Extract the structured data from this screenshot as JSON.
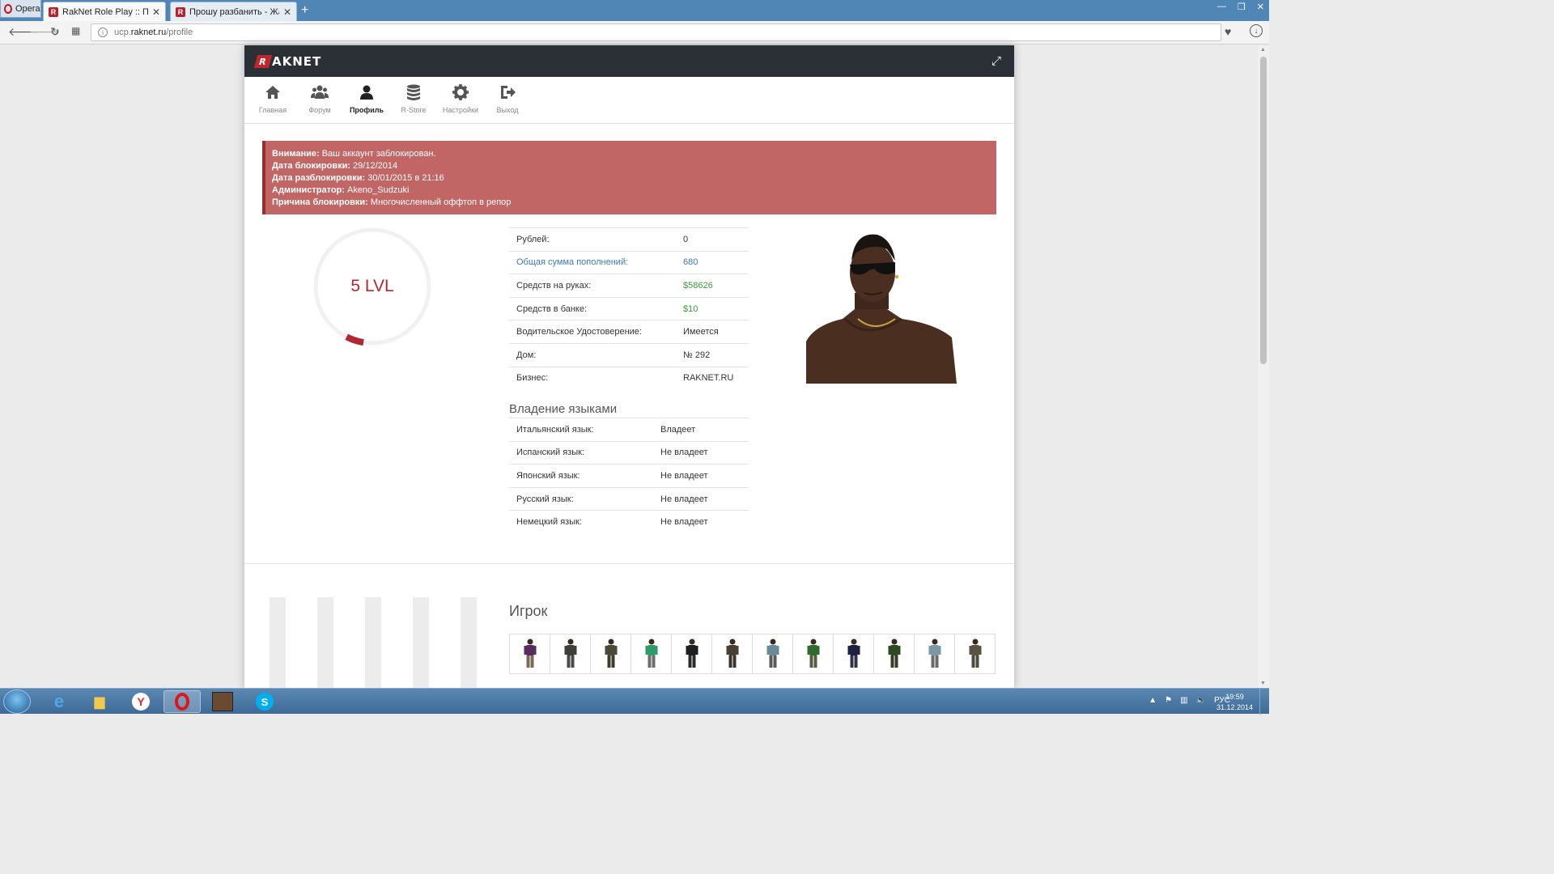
{
  "browser": {
    "menu_label": "Opera",
    "tabs": [
      {
        "title": "RakNet Role Play :: Профиль"
      },
      {
        "title": "Прошу разбанить - Жалобы"
      }
    ],
    "url_host": "ucp.",
    "url_domain": "raknet.ru",
    "url_path": "/profile"
  },
  "site": {
    "logo_text": "AKNET",
    "logo_mark": "R",
    "nav": [
      {
        "label": "Главная",
        "icon": "home-icon"
      },
      {
        "label": "Форум",
        "icon": "users-icon"
      },
      {
        "label": "Профиль",
        "icon": "user-icon"
      },
      {
        "label": "R-Store",
        "icon": "database-icon"
      },
      {
        "label": "Настройки",
        "icon": "gear-icon"
      },
      {
        "label": "Выход",
        "icon": "signout-icon"
      }
    ],
    "active_nav": "Профиль"
  },
  "ban": {
    "warning_label": "Внимание:",
    "warning_text": " Ваш аккаунт заблокирован.",
    "date_label": "Дата блокировки:",
    "date": " 29/12/2014",
    "unban_label": "Дата разблокировки:",
    "unban": " 30/01/2015 в 21:16",
    "admin_label": "Администратор:",
    "admin": " Akeno_Sudzuki",
    "reason_label": "Причина блокировки:",
    "reason": " Многочисленный оффтоп в репор"
  },
  "level": {
    "label": "5 LVL",
    "progress": 0.05,
    "color": "#b3262f"
  },
  "stats": [
    {
      "key": "Рублей:",
      "value": "0"
    },
    {
      "key": "Общая сумма пополнений:",
      "value": "680"
    },
    {
      "key": "Средств на руках:",
      "value": "$58626"
    },
    {
      "key": "Средств в банке:",
      "value": "$10"
    },
    {
      "key": "Водительское Удостоверение:",
      "value": "Имеется"
    },
    {
      "key": "Дом:",
      "value": "№ 292"
    },
    {
      "key": "Бизнес:",
      "value": "RAKNET.RU"
    }
  ],
  "languages_title": "Владение языками",
  "languages": [
    {
      "key": "Итальянский язык:",
      "value": "Владеет"
    },
    {
      "key": "Испанский язык:",
      "value": "Не владеет"
    },
    {
      "key": "Японский язык:",
      "value": "Не владеет"
    },
    {
      "key": "Русский язык:",
      "value": "Не владеет"
    },
    {
      "key": "Немецкий язык:",
      "value": "Не владеет"
    }
  ],
  "player_title": "Игрок",
  "skins": [
    {
      "shirt": "#5b2a5e",
      "pants": "#7a6a50"
    },
    {
      "shirt": "#3c3f3a",
      "pants": "#4a4a48"
    },
    {
      "shirt": "#4b4a36",
      "pants": "#3d3b2e"
    },
    {
      "shirt": "#2e9a6a",
      "pants": "#6d6d6d"
    },
    {
      "shirt": "#1d1d22",
      "pants": "#2a2a2e"
    },
    {
      "shirt": "#4a3f33",
      "pants": "#3b342c"
    },
    {
      "shirt": "#6a8a99",
      "pants": "#5a5a5a"
    },
    {
      "shirt": "#2f6a2e",
      "pants": "#5a5a40"
    },
    {
      "shirt": "#1e2240",
      "pants": "#30344a"
    },
    {
      "shirt": "#2d4a22",
      "pants": "#3a3a2a"
    },
    {
      "shirt": "#7a98a8",
      "pants": "#6a6a6a"
    },
    {
      "shirt": "#5a5140",
      "pants": "#4e4a3e"
    }
  ],
  "taskbar": {
    "lang": "РУС",
    "time": "19:59",
    "date": "31.12.2014",
    "apps": [
      "ie-icon",
      "explorer-icon",
      "yandex-icon",
      "opera-icon",
      "gta-icon",
      "skype-icon"
    ]
  }
}
